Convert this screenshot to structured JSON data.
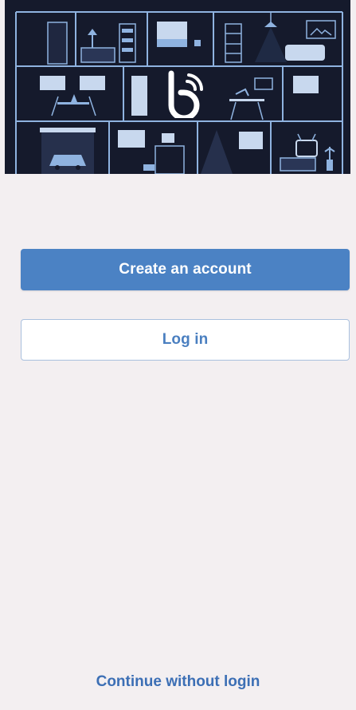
{
  "hero": {
    "illustration_icon": "house-cutaway-illustration",
    "logo_icon": "app-logo-icon",
    "background_color": "#151a2c",
    "accent_color": "#8fb3e0"
  },
  "actions": {
    "create_account_label": "Create an account",
    "login_label": "Log in",
    "continue_label": "Continue without login",
    "primary_color": "#4b82c4"
  }
}
